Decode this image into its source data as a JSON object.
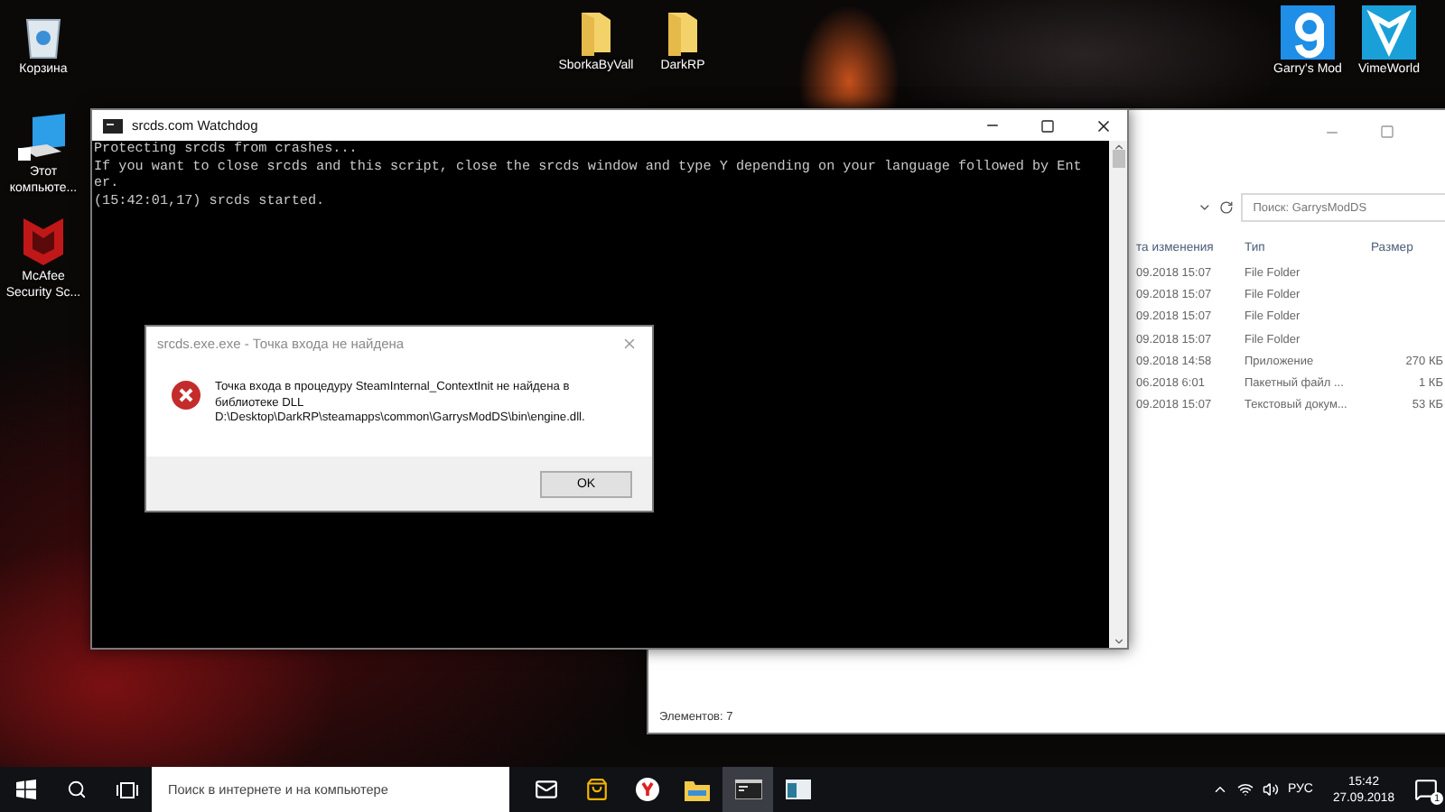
{
  "desktop_icons": [
    {
      "label": "Корзина",
      "kind": "recycle"
    },
    {
      "label": "Этот компьюте...",
      "kind": "computer"
    },
    {
      "label": "McAfee Security Sc...",
      "kind": "mcafee"
    },
    {
      "label": "SborkaByVall",
      "kind": "folder"
    },
    {
      "label": "DarkRP",
      "kind": "folder"
    },
    {
      "label": "Garry's Mod",
      "kind": "gmod"
    },
    {
      "label": "VimeWorld",
      "kind": "vime"
    }
  ],
  "explorer": {
    "search": {
      "placeholder": "Поиск: GarrysModDS"
    },
    "columns": [
      "та изменения",
      "Тип",
      "Размер"
    ],
    "rows": [
      {
        "date": "09.2018 15:07",
        "type": "File Folder",
        "size": ""
      },
      {
        "date": "09.2018 15:07",
        "type": "File Folder",
        "size": ""
      },
      {
        "date": "09.2018 15:07",
        "type": "File Folder",
        "size": ""
      },
      {
        "date": "09.2018 15:07",
        "type": "File Folder",
        "size": ""
      },
      {
        "date": "09.2018 14:58",
        "type": "Приложение",
        "size": "270 КБ"
      },
      {
        "date": "06.2018 6:01",
        "type": "Пакетный файл ...",
        "size": "1 КБ"
      },
      {
        "date": "09.2018 15:07",
        "type": "Текстовый докум...",
        "size": "53 КБ"
      }
    ],
    "status": "Элементов: 7"
  },
  "console": {
    "title": "srcds.com Watchdog",
    "lines": [
      "Protecting srcds from crashes...",
      "If you want to close srcds and this script, close the srcds window and type Y depending on your language followed by Ent",
      "er.",
      "(15:42:01,17) srcds started."
    ]
  },
  "dialog": {
    "title": "srcds.exe.exe - Точка входа не найдена",
    "message": "Точка входа в процедуру SteamInternal_ContextInit не найдена в библиотеке DLL D:\\Desktop\\DarkRP\\steamapps\\common\\GarrysModDS\\bin\\engine.dll.",
    "button": "OK"
  },
  "taskbar": {
    "search": {
      "placeholder": "Поиск в интернете и на компьютере"
    },
    "apps": [
      {
        "kind": "mail",
        "selected": false
      },
      {
        "kind": "store",
        "selected": false
      },
      {
        "kind": "yandex",
        "selected": false
      },
      {
        "kind": "explorer",
        "selected": false
      },
      {
        "kind": "console",
        "selected": true
      },
      {
        "kind": "window",
        "selected": false
      }
    ],
    "language": "РУС",
    "time": "15:42",
    "date": "27.09.2018",
    "notifications": "1"
  }
}
